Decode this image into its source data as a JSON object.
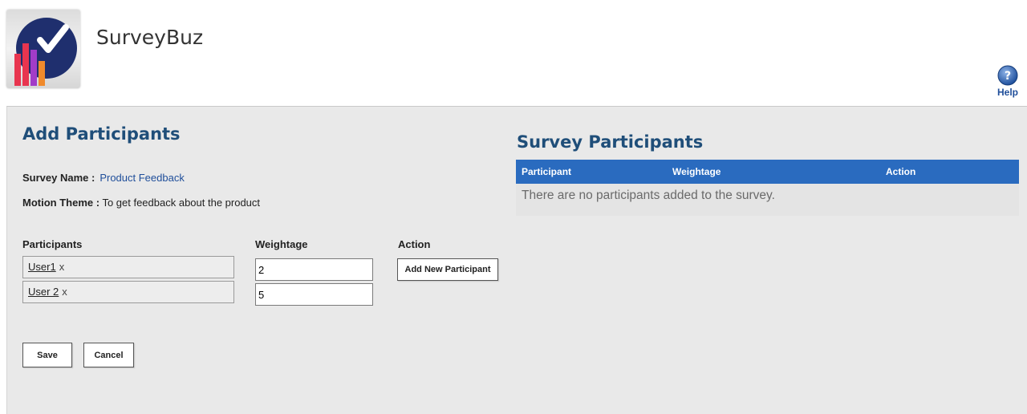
{
  "header": {
    "app_title": "SurveyBuz",
    "help_label": "Help",
    "logo_colors": [
      "#1f2f6e",
      "#e8354f",
      "#a23cc8",
      "#f08a2c",
      "#ffffff"
    ]
  },
  "add_participants": {
    "title": "Add Participants",
    "survey_name_label": "Survey Name :",
    "survey_name_value": "Product Feedback",
    "motion_theme_label": "Motion Theme :",
    "motion_theme_value": "To get feedback about the product",
    "columns": {
      "participants": "Participants",
      "weightage": "Weightage",
      "action": "Action"
    },
    "rows": [
      {
        "participant": "User1",
        "remove": "x",
        "weightage": "2"
      },
      {
        "participant": "User 2",
        "remove": "x",
        "weightage": "5"
      }
    ],
    "add_new_participant_label": "Add New Participant",
    "save_label": "Save",
    "cancel_label": "Cancel"
  },
  "survey_participants": {
    "title": "Survey Participants",
    "columns": {
      "participant": "Participant",
      "weightage": "Weightage",
      "action": "Action"
    },
    "empty_message": "There are no participants added to the survey.",
    "header_color": "#2a6bbf"
  },
  "colors": {
    "title_blue": "#1f4e79",
    "link_blue": "#1f4e9a",
    "panel_bg": "#e9e9e9"
  }
}
